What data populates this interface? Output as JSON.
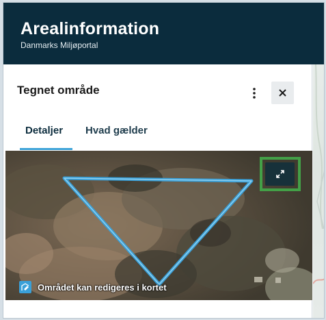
{
  "header": {
    "title": "Arealinformation",
    "subtitle": "Danmarks Miljøportal"
  },
  "panel": {
    "title": "Tegnet område",
    "more_icon": "more-vertical-icon",
    "close_icon": "close-icon",
    "tabs": [
      {
        "label": "Detaljer",
        "active": true
      },
      {
        "label": "Hvad gælder",
        "active": false
      }
    ]
  },
  "thumbnail": {
    "expand_icon": "expand-icon",
    "edit_icon": "edit-polygon-icon",
    "edit_note": "Området kan redigeres i kortet",
    "polygon_color": "#3aa0d8"
  },
  "colors": {
    "header_bg": "#0b2c3d",
    "accent": "#3da3d8",
    "highlight": "#43a047"
  }
}
